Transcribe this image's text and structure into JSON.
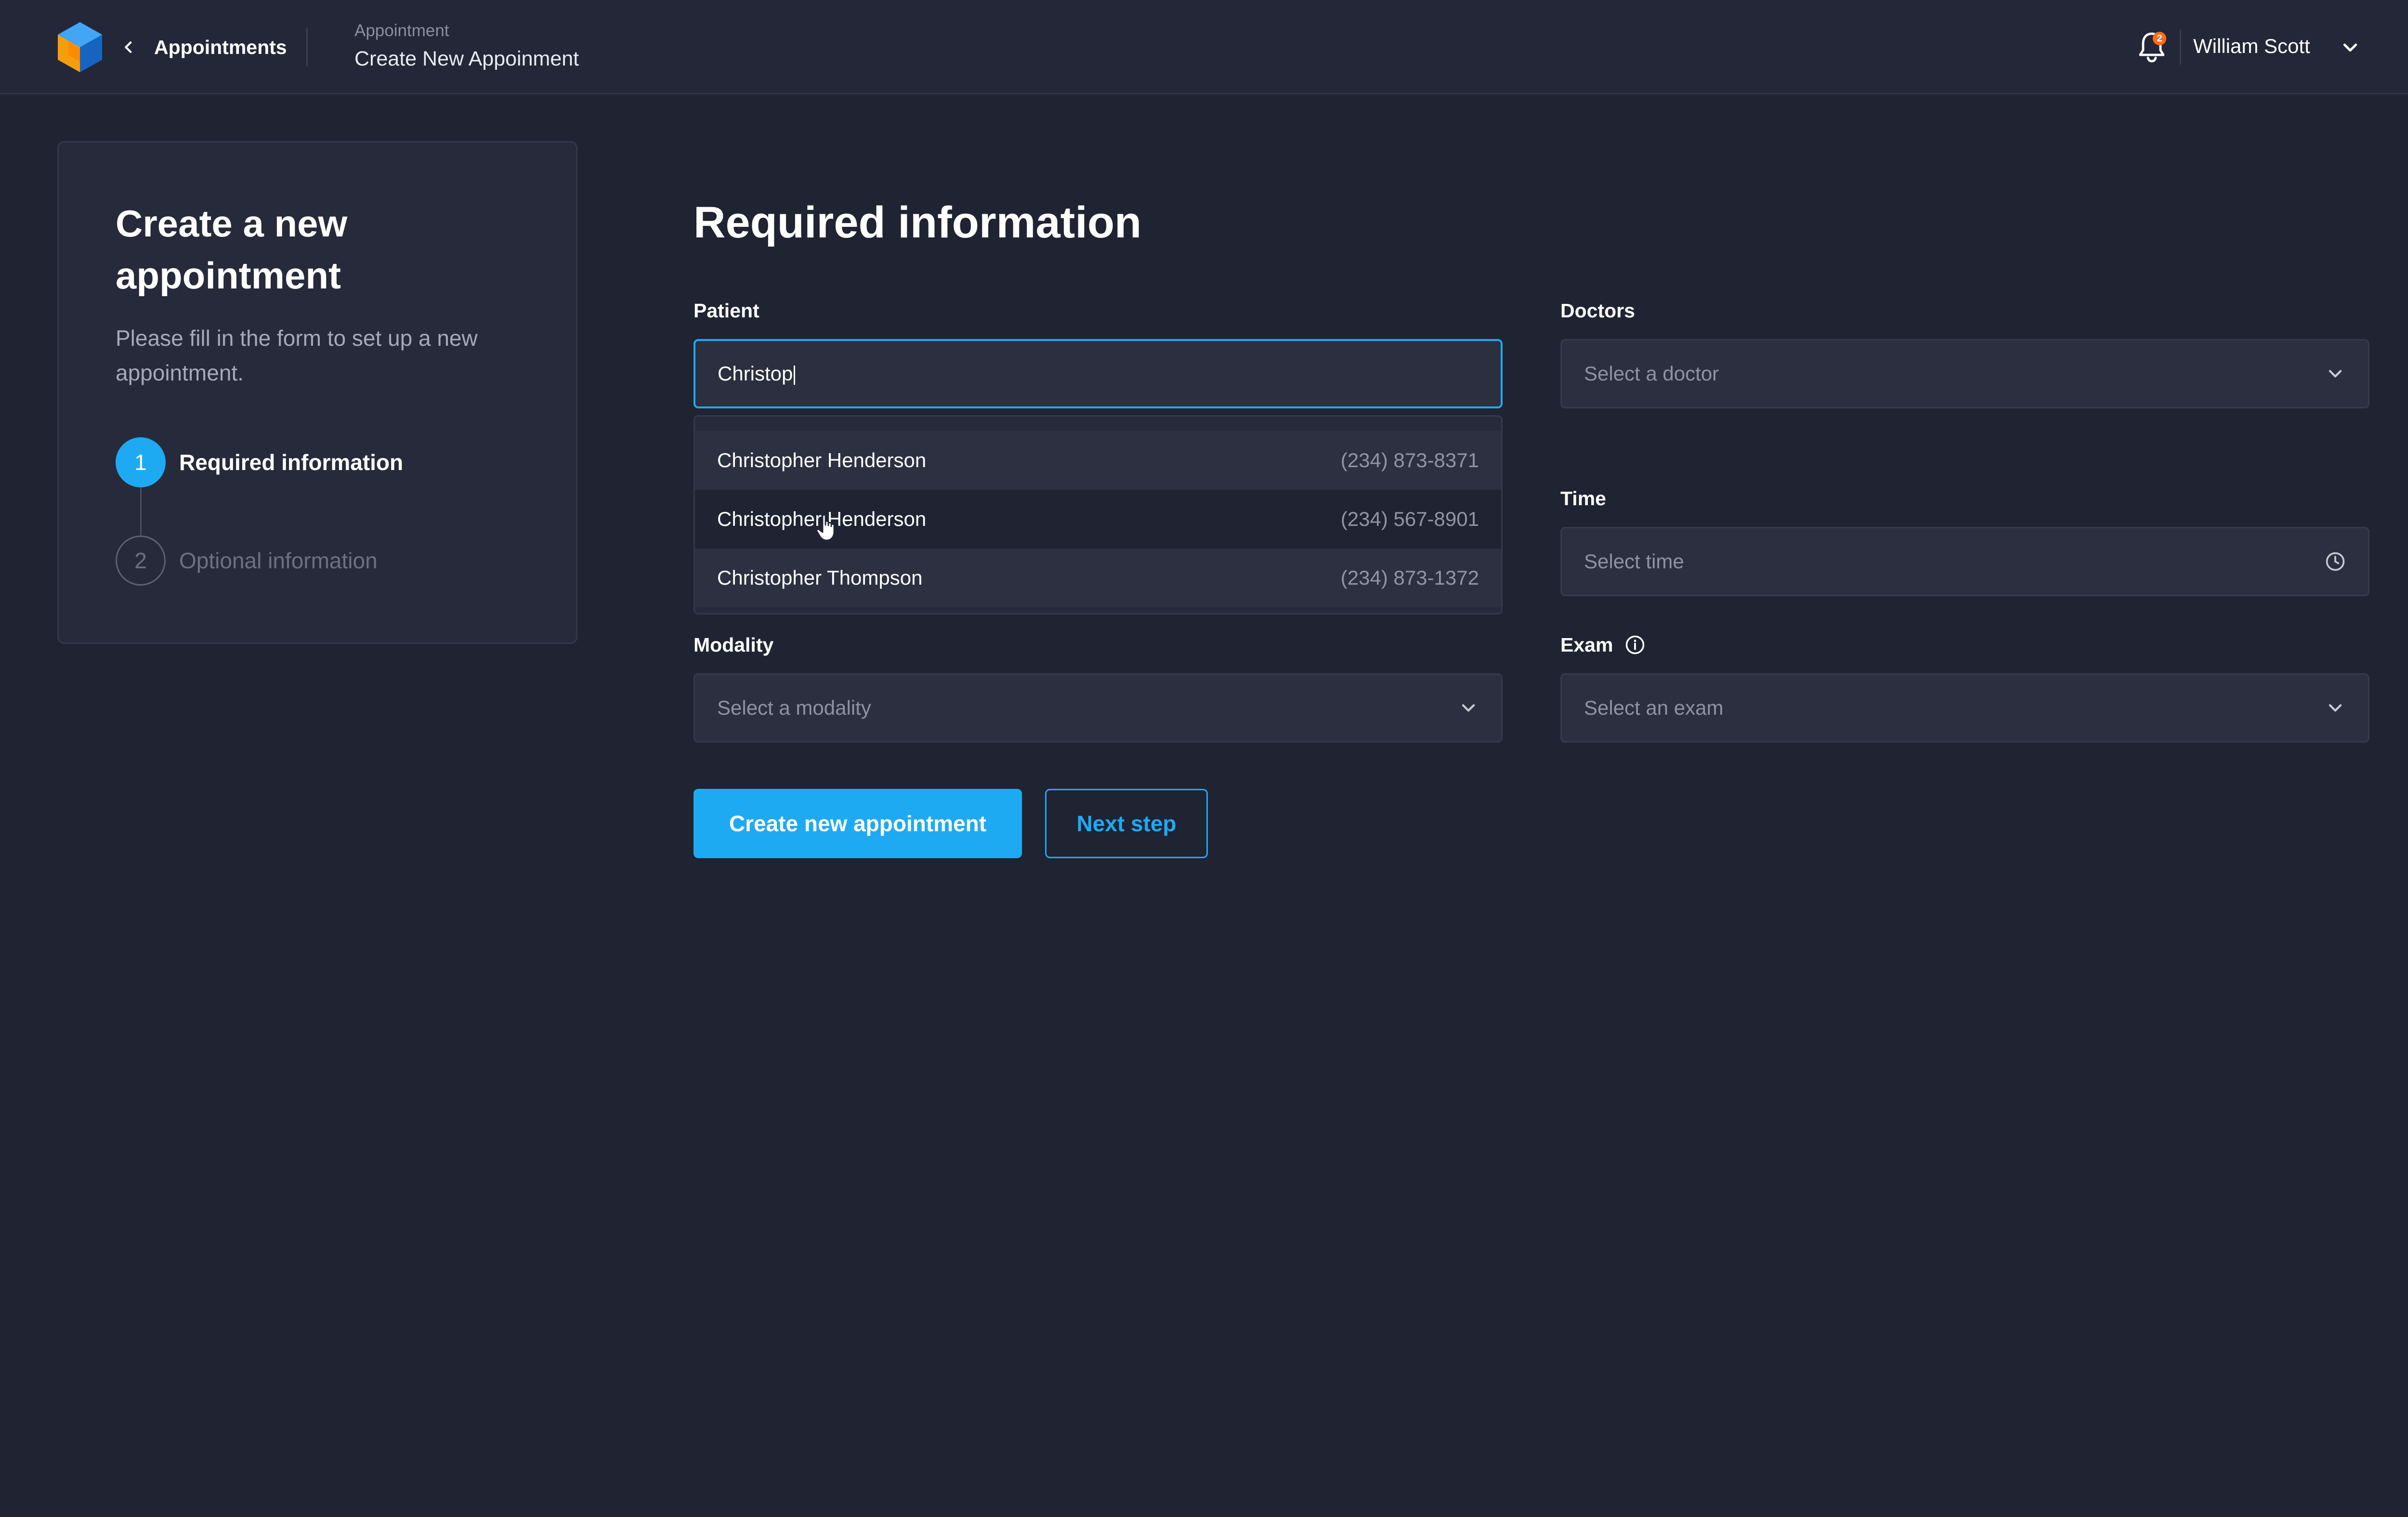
{
  "header": {
    "back_label": "Appointments",
    "breadcrumb_small": "Appointment",
    "breadcrumb_title": "Create New Appoinment",
    "notification_count": "2",
    "user_name": "William Scott"
  },
  "sidebar": {
    "title": "Create a new appointment",
    "description": "Please fill in the form to set up a new appointment.",
    "steps": [
      {
        "number": "1",
        "label": "Required information",
        "active": true
      },
      {
        "number": "2",
        "label": "Optional information",
        "active": false
      }
    ]
  },
  "form": {
    "title": "Required information",
    "patient": {
      "label": "Patient",
      "value": "Christop"
    },
    "doctors": {
      "label": "Doctors",
      "placeholder": "Select a doctor"
    },
    "time": {
      "label": "Time",
      "placeholder": "Select time"
    },
    "modality": {
      "label": "Modality",
      "placeholder": "Select a modality"
    },
    "exam": {
      "label": "Exam",
      "placeholder": "Select an exam"
    }
  },
  "patient_suggestions": [
    {
      "name": "Christopher Henderson",
      "phone": "(234) 873-8371"
    },
    {
      "name": "Christopher Henderson",
      "phone": "(234) 567-8901"
    },
    {
      "name": "Christopher Thompson",
      "phone": "(234) 873-1372"
    }
  ],
  "actions": {
    "primary": "Create new appointment",
    "secondary": "Next step"
  },
  "colors": {
    "background": "#1f2332",
    "accent": "#1eaaf3",
    "badge": "#ff6b1a"
  },
  "icons": [
    "app-logo",
    "chevron-left-icon",
    "bell-icon",
    "chevron-down-icon",
    "clock-icon",
    "info-icon",
    "hand-cursor-icon"
  ]
}
